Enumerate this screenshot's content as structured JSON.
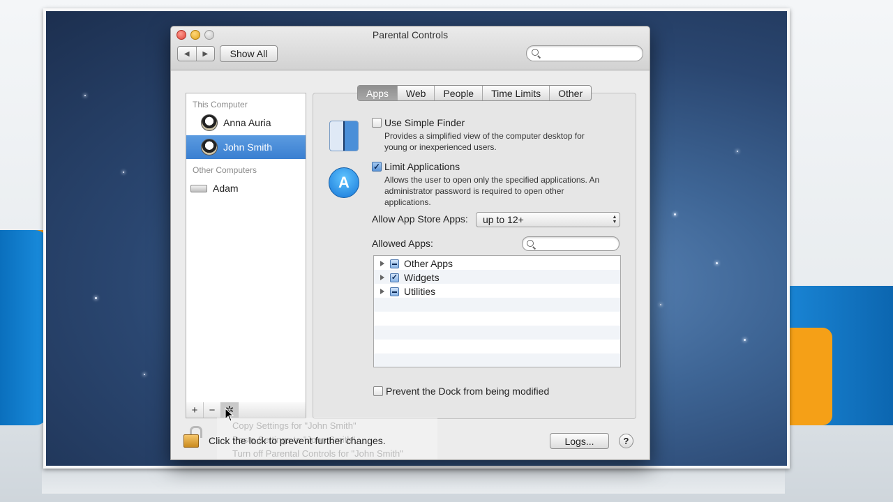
{
  "window": {
    "title": "Parental Controls",
    "nav_back": "◀",
    "nav_forward": "▶",
    "show_all_label": "Show All",
    "search_placeholder": ""
  },
  "sidebar": {
    "this_computer_header": "This Computer",
    "other_computers_header": "Other Computers",
    "users": [
      {
        "name": "Anna Auria",
        "selected": false
      },
      {
        "name": "John Smith",
        "selected": true
      }
    ],
    "computers": [
      {
        "name": "Adam"
      }
    ],
    "bottom_buttons": {
      "add": "+",
      "remove": "−",
      "action": "✲"
    }
  },
  "tabs": [
    {
      "label": "Apps",
      "active": true
    },
    {
      "label": "Web",
      "active": false
    },
    {
      "label": "People",
      "active": false
    },
    {
      "label": "Time Limits",
      "active": false
    },
    {
      "label": "Other",
      "active": false
    }
  ],
  "apps_tab": {
    "simple_finder": {
      "label": "Use Simple Finder",
      "checked": false,
      "description_line1": "Provides a simplified view of the computer desktop for",
      "description_line2": "young or inexperienced users."
    },
    "limit_apps": {
      "label": "Limit Applications",
      "checked": true,
      "description_line1": "Allows the user to open only the specified applications. An",
      "description_line2": "administrator password is required to open other",
      "description_line3": "applications."
    },
    "app_store_label": "Allow App Store Apps:",
    "app_store_value": "up to 12+",
    "allowed_apps_label": "Allowed Apps:",
    "allowed_apps_search_placeholder": "",
    "allowed_apps": [
      {
        "name": "Other Apps",
        "state": "mixed"
      },
      {
        "name": "Widgets",
        "state": "checked"
      },
      {
        "name": "Utilities",
        "state": "mixed"
      }
    ],
    "prevent_dock": {
      "label": "Prevent the Dock from being modified",
      "checked": false
    }
  },
  "footer": {
    "lock_text": "Click the lock to prevent further changes.",
    "logs_label": "Logs...",
    "help_label": "?"
  },
  "action_menu": {
    "items": [
      "Copy Settings for \"John Smith\"",
      "Paste Settings to \"John Smith\"",
      "Turn off Parental Controls for \"John Smith\""
    ]
  },
  "colors": {
    "selection": "#3a7fd1",
    "active_tab": "#9a9a9a",
    "window_bg": "#ececec"
  }
}
